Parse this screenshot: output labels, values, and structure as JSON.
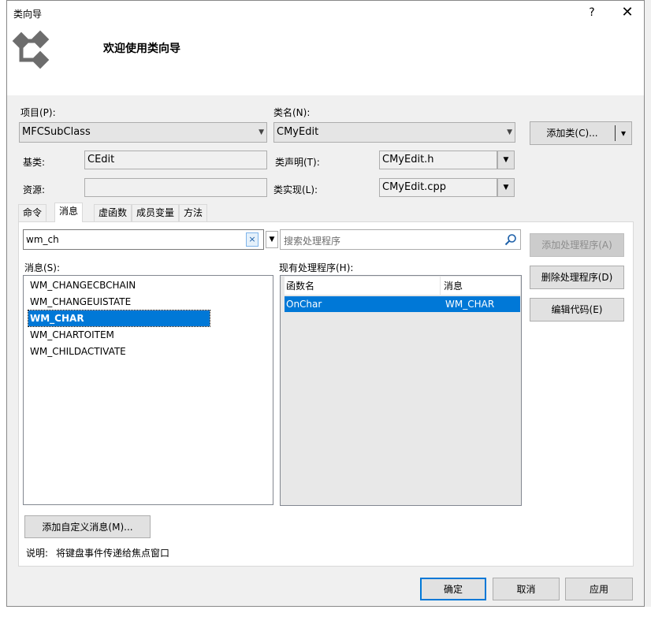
{
  "window": {
    "title": "类向导",
    "help_label": "?",
    "close_label": "✕"
  },
  "banner": {
    "title": "欢迎使用类向导",
    "icon": "class-wizard-icon"
  },
  "project": {
    "label": "项目(P):",
    "value": "MFCSubClass"
  },
  "class_name": {
    "label": "类名(N):",
    "value": "CMyEdit"
  },
  "add_class_button": {
    "label": "添加类(C)...",
    "arrow": "▾"
  },
  "base_class": {
    "label": "基类:",
    "value": "CEdit"
  },
  "resource": {
    "label": "资源:",
    "value": ""
  },
  "class_declaration": {
    "label": "类声明(T):",
    "value": "CMyEdit.h"
  },
  "class_implementation": {
    "label": "类实现(L):",
    "value": "CMyEdit.cpp"
  },
  "tabs": [
    {
      "label": "命令"
    },
    {
      "label": "消息"
    },
    {
      "label": "虚函数"
    },
    {
      "label": "成员变量"
    },
    {
      "label": "方法"
    }
  ],
  "active_tab": "消息",
  "filter": {
    "value": "wm_ch",
    "clear_label": "×"
  },
  "search": {
    "placeholder": "搜索处理程序"
  },
  "messages": {
    "label": "消息(S):",
    "items": [
      "WM_CHANGECBCHAIN",
      "WM_CHANGEUISTATE",
      "WM_CHAR",
      "WM_CHARTOITEM",
      "WM_CHILDACTIVATE"
    ],
    "selected": "WM_CHAR"
  },
  "handlers": {
    "label": "现有处理程序(H):",
    "columns": [
      "函数名",
      "消息"
    ],
    "rows": [
      {
        "function": "OnChar",
        "message": "WM_CHAR"
      }
    ]
  },
  "buttons": {
    "add_handler": "添加处理程序(A)",
    "delete_handler": "删除处理程序(D)",
    "edit_code": "编辑代码(E)",
    "add_custom_message": "添加自定义消息(M)...",
    "ok": "确定",
    "cancel": "取消",
    "apply": "应用"
  },
  "description": {
    "label": "说明:",
    "text": "将键盘事件传递给焦点窗口"
  },
  "colors": {
    "accent": "#0078d7",
    "dialog_bg": "#f0f0f0"
  }
}
